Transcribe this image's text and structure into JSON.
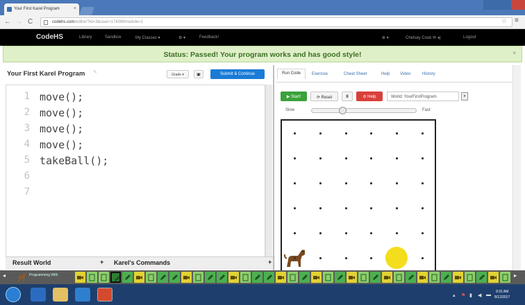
{
  "browser": {
    "tab_title": "Your First Karel Program",
    "url_host": "codehs.com",
    "url_path": "/editor/?id=3&user=174088module=1"
  },
  "nav": {
    "logo": "CodeHS",
    "library": "Library",
    "sandbox": "Sandbox",
    "my_classes": "My Classes ▾",
    "gear": "⚙ ▾",
    "feedback": "Feedback!",
    "bell": "⊕ ▾",
    "user": "Chelsey Cook ✉ ◂)",
    "logout": "Logout"
  },
  "status": {
    "message": "Status: Passed! Your program works and has good style!"
  },
  "editor": {
    "title": "Your First Karel Program",
    "grade_label": "Grade ▾",
    "submit_label": "Submit & Continue",
    "lines": [
      {
        "n": "1",
        "code": "move();"
      },
      {
        "n": "2",
        "code": "move();"
      },
      {
        "n": "3",
        "code": "move();"
      },
      {
        "n": "4",
        "code": "move();"
      },
      {
        "n": "5",
        "code": "takeBall();"
      },
      {
        "n": "6",
        "code": ""
      },
      {
        "n": "7",
        "code": ""
      }
    ]
  },
  "bottom": {
    "result_world": "Result World",
    "karels_commands": "Karel's Commands"
  },
  "right": {
    "tabs": [
      "Run Code",
      "Exercise",
      "Cheat Sheet",
      "Help",
      "Video",
      "History"
    ]
  },
  "controls": {
    "start": "▶ Start!",
    "reset": "⟳ Reset",
    "pause": "II",
    "help": "⊘ Help",
    "world": "World: YourFirstProgram"
  },
  "speed": {
    "slow": "Slow",
    "fast": "Fast",
    "value": 0.28
  },
  "world": {
    "columns": 6,
    "rows": 6,
    "karel": {
      "col": 0,
      "row": 0,
      "facing": "east"
    },
    "ball": {
      "col": 4,
      "row": 0
    },
    "colors": {
      "ball": "#f3dd1c",
      "karel": "#7a4a1e",
      "grid_dot": "#333333"
    }
  },
  "taskbar": {
    "course": "Programming With",
    "colors": {
      "done": "#4caf50",
      "current": "#2e7d32",
      "video": "#e0d234",
      "exercise_alt": "#8ccf6a"
    },
    "items": [
      "video",
      "doc",
      "doc",
      "pencil-current",
      "pencil",
      "video",
      "doc",
      "pencil",
      "pencil",
      "video",
      "doc",
      "pencil",
      "pencil",
      "video",
      "doc",
      "pencil",
      "pencil",
      "video",
      "doc",
      "pencil",
      "video",
      "doc",
      "pencil",
      "video",
      "doc",
      "pencil",
      "video",
      "doc",
      "pencil",
      "video",
      "doc",
      "pencil",
      "video",
      "doc",
      "pencil",
      "video",
      "doc"
    ]
  },
  "os": {
    "time": "9:31 AM",
    "date": "8/12/2017"
  }
}
